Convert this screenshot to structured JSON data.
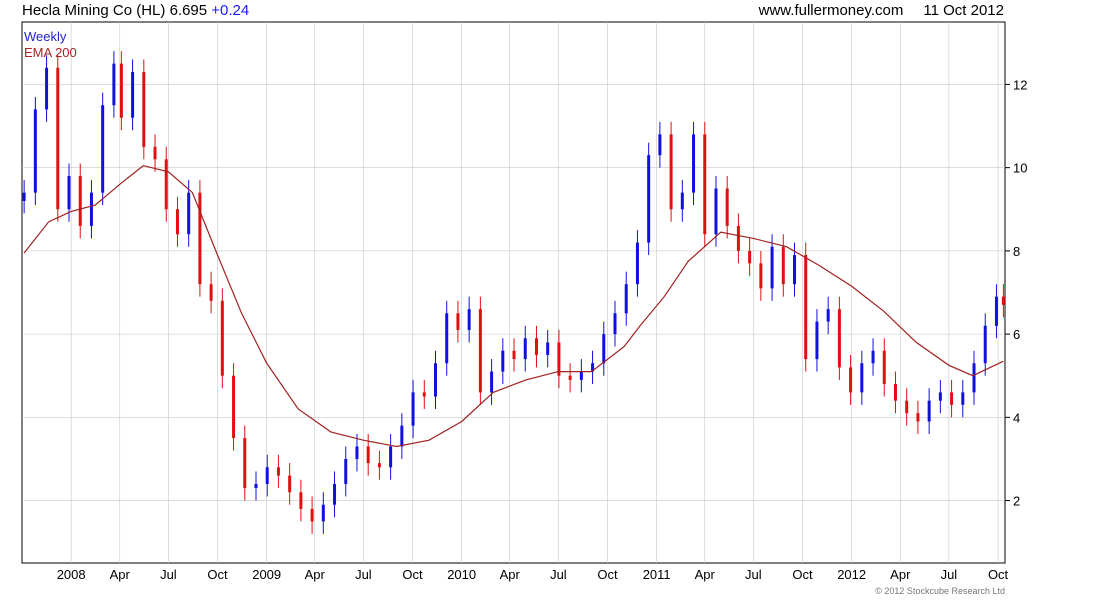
{
  "header": {
    "name": "Hecla Mining Co (HL)",
    "price": "6.695",
    "change": "+0.24",
    "site": "www.fullermoney.com",
    "date": "11 Oct 2012"
  },
  "legend": {
    "weekly": "Weekly",
    "ema": "EMA 200"
  },
  "copyright": "© 2012 Stockcube Research Ltd",
  "colors": {
    "up": "#1010e0",
    "down": "#e01010",
    "ema": "#a02020",
    "grid": "#c8c8c8"
  },
  "chart_data": {
    "type": "candlestick",
    "x_range": [
      "2007-10-01",
      "2012-10-14"
    ],
    "y_range": [
      0.5,
      13.5
    ],
    "y_ticks": [
      2,
      4,
      6,
      8,
      10,
      12
    ],
    "x_tick_labels": [
      {
        "label": "2008",
        "date": "2008-01-01"
      },
      {
        "label": "Apr",
        "date": "2008-04-01"
      },
      {
        "label": "Jul",
        "date": "2008-07-01"
      },
      {
        "label": "Oct",
        "date": "2008-10-01"
      },
      {
        "label": "2009",
        "date": "2009-01-01"
      },
      {
        "label": "Apr",
        "date": "2009-04-01"
      },
      {
        "label": "Jul",
        "date": "2009-07-01"
      },
      {
        "label": "Oct",
        "date": "2009-10-01"
      },
      {
        "label": "2010",
        "date": "2010-01-01"
      },
      {
        "label": "Apr",
        "date": "2010-04-01"
      },
      {
        "label": "Jul",
        "date": "2010-07-01"
      },
      {
        "label": "Oct",
        "date": "2010-10-01"
      },
      {
        "label": "2011",
        "date": "2011-01-01"
      },
      {
        "label": "Apr",
        "date": "2011-04-01"
      },
      {
        "label": "Jul",
        "date": "2011-07-01"
      },
      {
        "label": "Oct",
        "date": "2011-10-01"
      },
      {
        "label": "2012",
        "date": "2012-01-01"
      },
      {
        "label": "Apr",
        "date": "2012-04-01"
      },
      {
        "label": "Jul",
        "date": "2012-07-01"
      },
      {
        "label": "Oct",
        "date": "2012-10-01"
      }
    ],
    "series": [
      {
        "name": "Weekly",
        "style": "candles",
        "points": [
          {
            "date": "2007-10-05",
            "value": 9.4
          },
          {
            "date": "2007-10-26",
            "value": 11.4
          },
          {
            "date": "2007-11-16",
            "value": 12.4
          },
          {
            "date": "2007-12-07",
            "value": 9.0
          },
          {
            "date": "2007-12-28",
            "value": 9.8
          },
          {
            "date": "2008-01-18",
            "value": 8.6
          },
          {
            "date": "2008-02-08",
            "value": 9.4
          },
          {
            "date": "2008-02-29",
            "value": 11.5
          },
          {
            "date": "2008-03-21",
            "value": 12.5
          },
          {
            "date": "2008-04-04",
            "value": 11.2
          },
          {
            "date": "2008-04-25",
            "value": 12.3
          },
          {
            "date": "2008-05-16",
            "value": 10.5
          },
          {
            "date": "2008-06-06",
            "value": 10.2
          },
          {
            "date": "2008-06-27",
            "value": 9.0
          },
          {
            "date": "2008-07-18",
            "value": 8.4
          },
          {
            "date": "2008-08-08",
            "value": 9.4
          },
          {
            "date": "2008-08-29",
            "value": 7.2
          },
          {
            "date": "2008-09-19",
            "value": 6.8
          },
          {
            "date": "2008-10-10",
            "value": 5.0
          },
          {
            "date": "2008-10-31",
            "value": 3.5
          },
          {
            "date": "2008-11-21",
            "value": 2.3
          },
          {
            "date": "2008-12-12",
            "value": 2.4
          },
          {
            "date": "2009-01-02",
            "value": 2.8
          },
          {
            "date": "2009-01-23",
            "value": 2.6
          },
          {
            "date": "2009-02-13",
            "value": 2.2
          },
          {
            "date": "2009-03-06",
            "value": 1.8
          },
          {
            "date": "2009-03-27",
            "value": 1.5
          },
          {
            "date": "2009-04-17",
            "value": 1.9
          },
          {
            "date": "2009-05-08",
            "value": 2.4
          },
          {
            "date": "2009-05-29",
            "value": 3.0
          },
          {
            "date": "2009-06-19",
            "value": 3.3
          },
          {
            "date": "2009-07-10",
            "value": 2.9
          },
          {
            "date": "2009-07-31",
            "value": 2.8
          },
          {
            "date": "2009-08-21",
            "value": 3.3
          },
          {
            "date": "2009-09-11",
            "value": 3.8
          },
          {
            "date": "2009-10-02",
            "value": 4.6
          },
          {
            "date": "2009-10-23",
            "value": 4.5
          },
          {
            "date": "2009-11-13",
            "value": 5.3
          },
          {
            "date": "2009-12-04",
            "value": 6.5
          },
          {
            "date": "2009-12-25",
            "value": 6.1
          },
          {
            "date": "2010-01-15",
            "value": 6.6
          },
          {
            "date": "2010-02-05",
            "value": 4.6
          },
          {
            "date": "2010-02-26",
            "value": 5.1
          },
          {
            "date": "2010-03-19",
            "value": 5.6
          },
          {
            "date": "2010-04-09",
            "value": 5.4
          },
          {
            "date": "2010-04-30",
            "value": 5.9
          },
          {
            "date": "2010-05-21",
            "value": 5.5
          },
          {
            "date": "2010-06-11",
            "value": 5.8
          },
          {
            "date": "2010-07-02",
            "value": 5.0
          },
          {
            "date": "2010-07-23",
            "value": 4.9
          },
          {
            "date": "2010-08-13",
            "value": 5.1
          },
          {
            "date": "2010-09-03",
            "value": 5.3
          },
          {
            "date": "2010-09-24",
            "value": 6.0
          },
          {
            "date": "2010-10-15",
            "value": 6.5
          },
          {
            "date": "2010-11-05",
            "value": 7.2
          },
          {
            "date": "2010-11-26",
            "value": 8.2
          },
          {
            "date": "2010-12-17",
            "value": 10.3
          },
          {
            "date": "2011-01-07",
            "value": 10.8
          },
          {
            "date": "2011-01-28",
            "value": 9.0
          },
          {
            "date": "2011-02-18",
            "value": 9.4
          },
          {
            "date": "2011-03-11",
            "value": 10.8
          },
          {
            "date": "2011-04-01",
            "value": 8.4
          },
          {
            "date": "2011-04-22",
            "value": 9.5
          },
          {
            "date": "2011-05-13",
            "value": 8.6
          },
          {
            "date": "2011-06-03",
            "value": 8.0
          },
          {
            "date": "2011-06-24",
            "value": 7.7
          },
          {
            "date": "2011-07-15",
            "value": 7.1
          },
          {
            "date": "2011-08-05",
            "value": 8.1
          },
          {
            "date": "2011-08-26",
            "value": 7.2
          },
          {
            "date": "2011-09-16",
            "value": 7.9
          },
          {
            "date": "2011-10-07",
            "value": 5.4
          },
          {
            "date": "2011-10-28",
            "value": 6.3
          },
          {
            "date": "2011-11-18",
            "value": 6.6
          },
          {
            "date": "2011-12-09",
            "value": 5.2
          },
          {
            "date": "2011-12-30",
            "value": 4.6
          },
          {
            "date": "2012-01-20",
            "value": 5.3
          },
          {
            "date": "2012-02-10",
            "value": 5.6
          },
          {
            "date": "2012-03-02",
            "value": 4.8
          },
          {
            "date": "2012-03-23",
            "value": 4.4
          },
          {
            "date": "2012-04-13",
            "value": 4.1
          },
          {
            "date": "2012-05-04",
            "value": 3.9
          },
          {
            "date": "2012-05-25",
            "value": 4.4
          },
          {
            "date": "2012-06-15",
            "value": 4.6
          },
          {
            "date": "2012-07-06",
            "value": 4.3
          },
          {
            "date": "2012-07-27",
            "value": 4.6
          },
          {
            "date": "2012-08-17",
            "value": 5.3
          },
          {
            "date": "2012-09-07",
            "value": 6.2
          },
          {
            "date": "2012-09-28",
            "value": 6.9
          },
          {
            "date": "2012-10-11",
            "value": 6.7
          }
        ]
      },
      {
        "name": "EMA 200",
        "style": "line",
        "points": [
          {
            "date": "2007-10-05",
            "value": 7.95
          },
          {
            "date": "2007-11-20",
            "value": 8.7
          },
          {
            "date": "2008-01-01",
            "value": 8.95
          },
          {
            "date": "2008-02-15",
            "value": 9.1
          },
          {
            "date": "2008-04-01",
            "value": 9.6
          },
          {
            "date": "2008-05-15",
            "value": 10.05
          },
          {
            "date": "2008-07-01",
            "value": 9.9
          },
          {
            "date": "2008-08-15",
            "value": 9.4
          },
          {
            "date": "2008-10-01",
            "value": 7.9
          },
          {
            "date": "2008-11-15",
            "value": 6.5
          },
          {
            "date": "2009-01-01",
            "value": 5.3
          },
          {
            "date": "2009-03-01",
            "value": 4.2
          },
          {
            "date": "2009-05-01",
            "value": 3.65
          },
          {
            "date": "2009-07-01",
            "value": 3.45
          },
          {
            "date": "2009-09-01",
            "value": 3.3
          },
          {
            "date": "2009-11-01",
            "value": 3.45
          },
          {
            "date": "2010-01-01",
            "value": 3.9
          },
          {
            "date": "2010-03-01",
            "value": 4.6
          },
          {
            "date": "2010-05-01",
            "value": 4.9
          },
          {
            "date": "2010-07-01",
            "value": 5.1
          },
          {
            "date": "2010-09-01",
            "value": 5.1
          },
          {
            "date": "2010-11-01",
            "value": 5.7
          },
          {
            "date": "2010-12-01",
            "value": 6.2
          },
          {
            "date": "2011-01-15",
            "value": 6.9
          },
          {
            "date": "2011-03-01",
            "value": 7.75
          },
          {
            "date": "2011-05-01",
            "value": 8.45
          },
          {
            "date": "2011-07-01",
            "value": 8.3
          },
          {
            "date": "2011-09-01",
            "value": 8.1
          },
          {
            "date": "2011-11-01",
            "value": 7.65
          },
          {
            "date": "2012-01-01",
            "value": 7.15
          },
          {
            "date": "2012-03-01",
            "value": 6.55
          },
          {
            "date": "2012-05-01",
            "value": 5.8
          },
          {
            "date": "2012-07-01",
            "value": 5.25
          },
          {
            "date": "2012-08-15",
            "value": 5.0
          },
          {
            "date": "2012-10-11",
            "value": 5.35
          }
        ]
      }
    ],
    "grid": true
  }
}
